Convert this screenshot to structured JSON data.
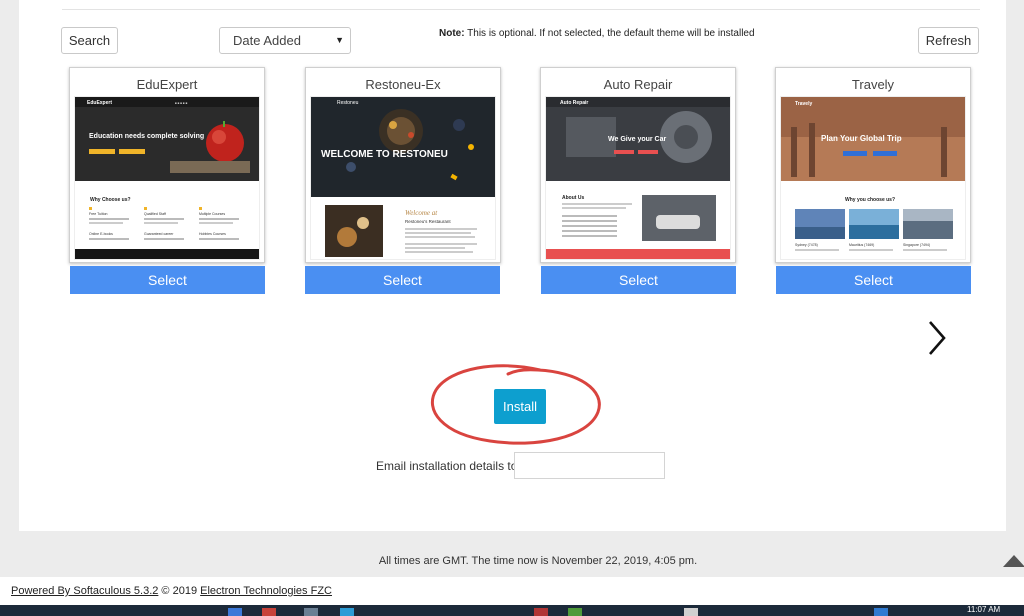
{
  "toolbar": {
    "search_label": "Search",
    "sort_selected": "Date Added",
    "note_bold": "Note:",
    "note_text": " This is optional. If not selected, the default theme will be installed",
    "refresh_label": "Refresh"
  },
  "themes": [
    {
      "name": "EduExpert",
      "select_label": "Select",
      "preview": {
        "brand": "EduExpert",
        "headline": "Education needs complete solving",
        "section": "Why Choose us?",
        "features": [
          "Free Tuition",
          "Qualified Staff",
          "Multiple Courses",
          "Online E-books",
          "Guaranteed career",
          "Hobbies Courses"
        ]
      }
    },
    {
      "name": "Restoneu-Ex",
      "select_label": "Select",
      "preview": {
        "brand": "Restoneu",
        "headline": "WELCOME TO RESTONEU",
        "welcome": "Welcome at",
        "subtitle": "Restoneu's Restaurant"
      }
    },
    {
      "name": "Auto Repair",
      "select_label": "Select",
      "preview": {
        "brand": "Auto Repair",
        "headline": "We Give your Car",
        "section": "About Us"
      }
    },
    {
      "name": "Travely",
      "select_label": "Select",
      "preview": {
        "brand": "Travely",
        "headline": "Plan Your Global Trip",
        "section": "Why you choose us?",
        "cities": [
          "Sydney (7478)",
          "Mauritius (7469)",
          "Singapore (7494)"
        ]
      }
    }
  ],
  "install": {
    "button_label": "Install",
    "email_label": "Email installation details to :",
    "email_value": ""
  },
  "status": {
    "time_text": "All times are GMT. The time now is November 22, 2019, 4:05 pm."
  },
  "footer": {
    "powered_link": "Powered By Softaculous 5.3.2",
    "copyright": " © 2019 ",
    "company_link": "Electron Technologies FZC"
  },
  "taskbar": {
    "clock": "11:07 AM"
  },
  "colors": {
    "select_button": "#4a8ff2",
    "install_button": "#0d9fcf",
    "annotation_circle": "#d9443f",
    "auto_repair_bar": "#e85050"
  }
}
